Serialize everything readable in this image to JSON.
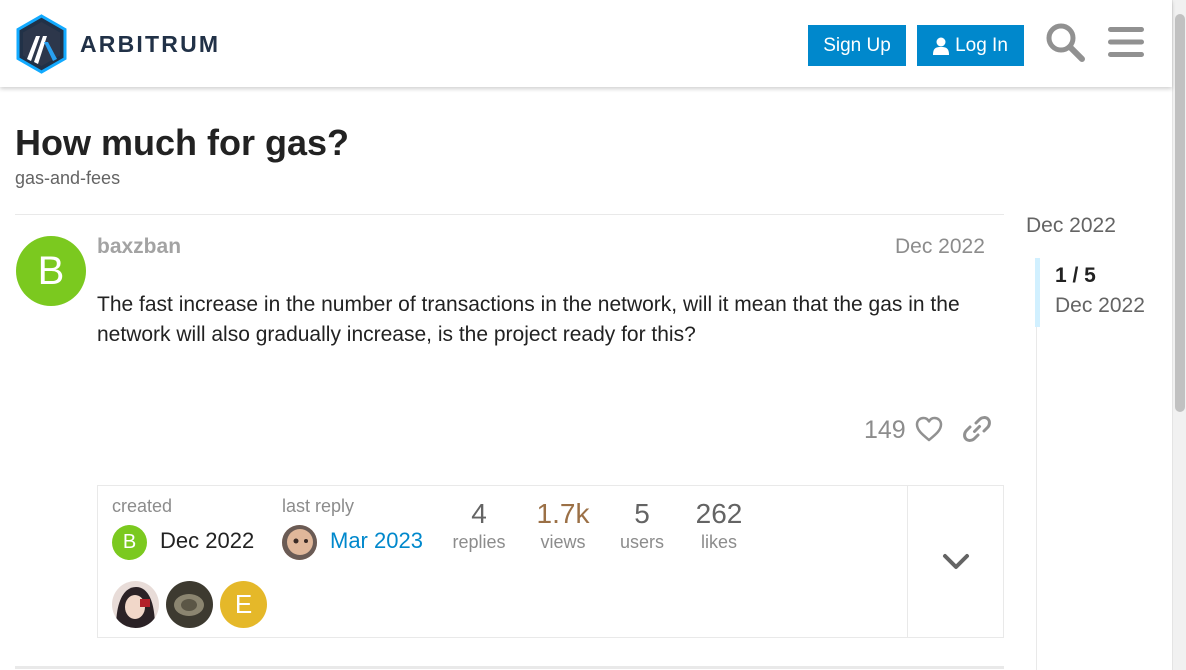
{
  "header": {
    "logo_text": "ARBITRUM",
    "signup_label": "Sign Up",
    "login_label": "Log In"
  },
  "topic": {
    "title": "How much for gas?",
    "tag": "gas-and-fees"
  },
  "post": {
    "avatar_letter": "B",
    "username": "baxzban",
    "date": "Dec 2022",
    "body": "The fast increase in the number of transactions in the network, will it mean that the gas in the network will also gradually increase, is the project ready for this?",
    "likes": "149"
  },
  "topic_map": {
    "created_label": "created",
    "created_avatar_letter": "B",
    "created_date": "Dec 2022",
    "last_reply_label": "last reply",
    "last_reply_date": "Mar 2023",
    "stats": [
      {
        "value": "4",
        "label": "replies"
      },
      {
        "value": "1.7k",
        "label": "views"
      },
      {
        "value": "5",
        "label": "users"
      },
      {
        "value": "262",
        "label": "likes"
      }
    ],
    "participant_letter": "E"
  },
  "timeline": {
    "top_date": "Dec 2022",
    "position": "1 / 5",
    "position_date": "Dec 2022"
  },
  "colors": {
    "accent": "#0088cc",
    "avatar_green": "#7bc91f",
    "avatar_yellow": "#e5b829",
    "views_highlight": "#9b7046",
    "timeline_handle": "#d1f0ff"
  }
}
